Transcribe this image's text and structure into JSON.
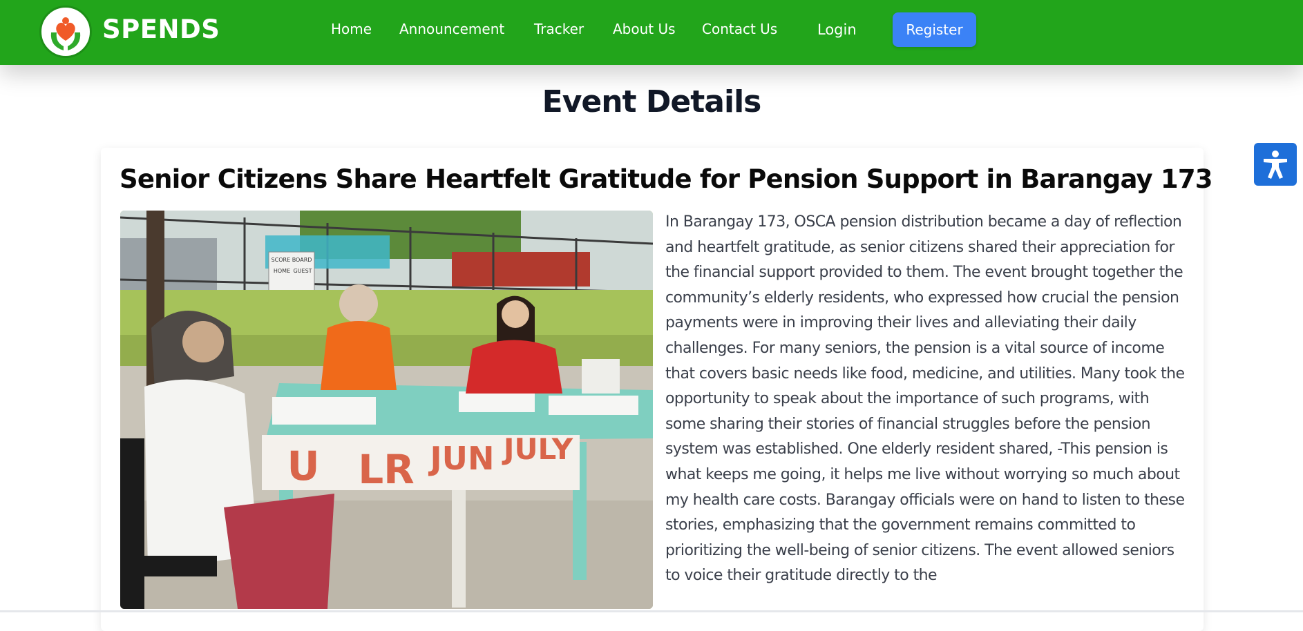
{
  "navbar": {
    "brand": "SPENDS",
    "links": [
      "Home",
      "Announcement",
      "Tracker",
      "About Us",
      "Contact Us"
    ],
    "login_label": "Login",
    "register_label": "Register",
    "colors": {
      "bar": "#22a51b",
      "register": "#3b82f6"
    }
  },
  "page": {
    "heading": "Event Details"
  },
  "article": {
    "title": "Senior Citizens Share Heartfelt Gratitude for Pension Support in Barangay 173",
    "photo_sign_texts": [
      "U",
      "LR",
      "JUN",
      "JULY"
    ],
    "photo_board_texts": [
      "SCORE BOARD",
      "HOME",
      "GUEST"
    ],
    "body": "In Barangay 173, OSCA pension distribution became a day of reflection and heartfelt gratitude, as senior citizens shared their appreciation for the financial support provided to them. The event brought together the community’s elderly residents, who expressed how crucial the pension payments were in improving their lives and alleviating their daily challenges. For many seniors, the pension is a vital source of income that covers basic needs like food, medicine, and utilities. Many took the opportunity to speak about the importance of such programs, with some sharing their stories of financial struggles before the pension system was established. One elderly resident shared, -This pension is what keeps me going, it helps me live without worrying so much about my health care costs. Barangay officials were on hand to listen to these stories, emphasizing that the government remains committed to prioritizing the well-being of senior citizens. The event allowed seniors to voice their gratitude directly to the"
  },
  "accessibility": {
    "icon": "accessibility-icon",
    "color": "#1e6fd9"
  }
}
